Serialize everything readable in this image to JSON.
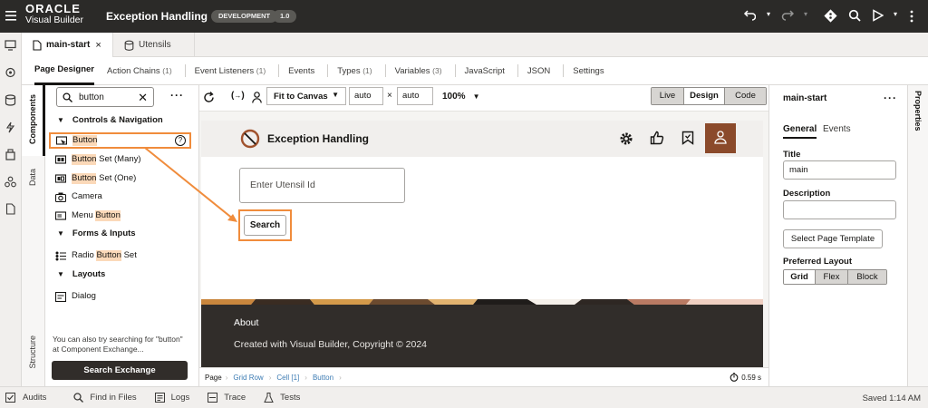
{
  "header": {
    "brand_line1": "ORACLE",
    "brand_line2": "Visual Builder",
    "app_title": "Exception Handling",
    "env_badge": "DEVELOPMENT",
    "version_badge": "1.0"
  },
  "file_tabs": [
    {
      "label": "main-start",
      "close": "×"
    },
    {
      "label": "Utensils"
    }
  ],
  "designer_tabs": [
    {
      "label": "Page Designer",
      "count": ""
    },
    {
      "label": "Action Chains",
      "count": "(1)"
    },
    {
      "label": "Event Listeners",
      "count": "(1)"
    },
    {
      "label": "Events",
      "count": ""
    },
    {
      "label": "Types",
      "count": "(1)"
    },
    {
      "label": "Variables",
      "count": "(3)"
    },
    {
      "label": "JavaScript",
      "count": ""
    },
    {
      "label": "JSON",
      "count": ""
    },
    {
      "label": "Settings",
      "count": ""
    }
  ],
  "side_tabs": {
    "components": "Components",
    "data": "Data",
    "structure": "Structure"
  },
  "components_panel": {
    "search_value": "button",
    "groups": {
      "controls": "Controls & Navigation",
      "forms": "Forms & Inputs",
      "layouts": "Layouts"
    },
    "items": {
      "button": {
        "match": "Button",
        "rest": ""
      },
      "button_set_many": {
        "match": "Button",
        "rest": " Set (Many)"
      },
      "button_set_one": {
        "match": "Button",
        "rest": " Set (One)"
      },
      "camera": {
        "label": "Camera"
      },
      "menu_button": {
        "pre": "Menu ",
        "match": "Button"
      },
      "radio_button_set": {
        "pre": "Radio ",
        "match": "Button",
        "rest": " Set"
      },
      "dialog": {
        "label": "Dialog"
      }
    },
    "hint": "You can also try searching for \"button\" at Component Exchange...",
    "exchange_button": "Search Exchange"
  },
  "canvas_toolbar": {
    "fit": "Fit to Canvas",
    "width": "auto",
    "times": "×",
    "height": "auto",
    "zoom": "100%",
    "modes": [
      "Live",
      "Design",
      "Code"
    ],
    "active_mode": "Design"
  },
  "preview": {
    "title": "Exception Handling",
    "input_placeholder": "Enter Utensil Id",
    "search_button": "Search",
    "footer_about": "About",
    "footer_copyright": "Created with Visual Builder, Copyright © 2024"
  },
  "breadcrumb": [
    "Page",
    "Grid Row",
    "Cell [1]",
    "Button"
  ],
  "render_time": "0.59 s",
  "properties": {
    "title": "main-start",
    "tabs": [
      "General",
      "Events"
    ],
    "title_label": "Title",
    "title_value": "main",
    "description_label": "Description",
    "description_value": "",
    "template_button": "Select Page Template",
    "layout_label": "Preferred Layout",
    "layout_options": [
      "Grid",
      "Flex",
      "Block"
    ],
    "vertical_tab": "Properties"
  },
  "bottom_bar": {
    "items": [
      "Audits",
      "Find in Files",
      "Logs",
      "Trace",
      "Tests"
    ],
    "status": "Saved 1:14 AM"
  },
  "colors": {
    "accent": "#f08c3c",
    "dark": "#2b2a28",
    "footer": "#312d2a"
  }
}
